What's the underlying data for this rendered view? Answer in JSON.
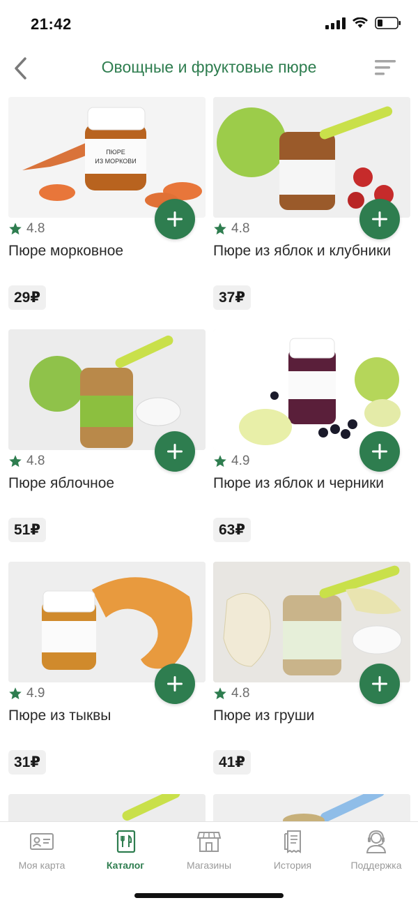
{
  "status_bar": {
    "time": "21:42"
  },
  "header": {
    "title": "Овощные и фруктовые пюре"
  },
  "products": [
    {
      "name": "Пюре морковное",
      "rating": "4.8",
      "price": "29₽",
      "image": "carrot-puree-jar"
    },
    {
      "name": "Пюре из яблок и клубники",
      "rating": "4.8",
      "price": "37₽",
      "image": "apple-strawberry-puree-jar"
    },
    {
      "name": "Пюре яблочное",
      "rating": "4.8",
      "price": "51₽",
      "image": "apple-puree-jar"
    },
    {
      "name": "Пюре из яблок и черники",
      "rating": "4.9",
      "price": "63₽",
      "image": "apple-blueberry-puree-jar"
    },
    {
      "name": "Пюре из тыквы",
      "rating": "4.9",
      "price": "31₽",
      "image": "pumpkin-puree-jar"
    },
    {
      "name": "Пюре из груши",
      "rating": "4.8",
      "price": "41₽",
      "image": "pear-puree-jar"
    }
  ],
  "tabbar": {
    "items": [
      {
        "label": "Моя карта",
        "icon": "card-icon"
      },
      {
        "label": "Каталог",
        "icon": "catalog-icon"
      },
      {
        "label": "Магазины",
        "icon": "store-icon"
      },
      {
        "label": "История",
        "icon": "receipt-icon"
      },
      {
        "label": "Поддержка",
        "icon": "support-icon"
      }
    ],
    "active": "Каталог"
  },
  "colors": {
    "accent": "#2e7d4f",
    "star": "#2e7d4f",
    "muted": "#9a9a9a"
  }
}
